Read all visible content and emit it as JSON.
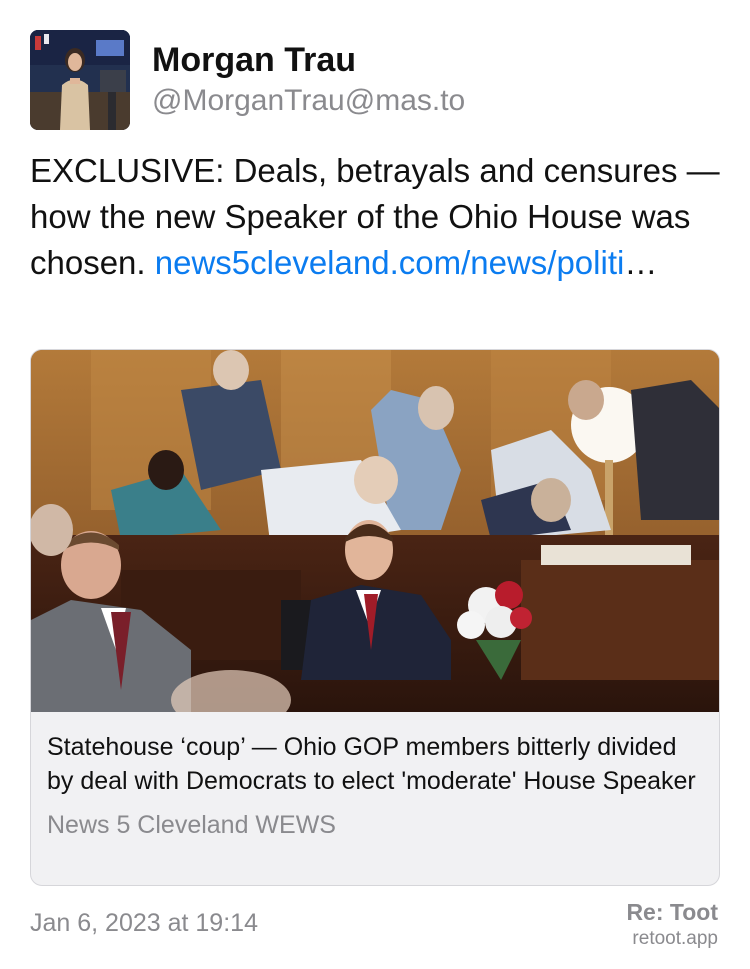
{
  "author": {
    "display_name": "Morgan Trau",
    "handle": "@MorganTrau@mas.to"
  },
  "post": {
    "text": "EXCLUSIVE: Deals, betrayals and censures — how the new Speaker of the Ohio House was chosen. ",
    "link_text": "news5cleveland.com/news/politi",
    "link_ellipsis": "…"
  },
  "link_card": {
    "title": "Statehouse ‘coup’ — Ohio GOP members bitterly divided by deal with Democrats to elect 'moderate' House Speaker",
    "source": "News 5 Cleveland WEWS"
  },
  "footer": {
    "date": "Jan 6, 2023 at 19:14",
    "brand_title": "Re: Toot",
    "brand_site": "retoot.app"
  },
  "colors": {
    "link": "#0b7cf0",
    "secondary_text": "#8a8a8e",
    "card_background": "#f1f1f3"
  }
}
